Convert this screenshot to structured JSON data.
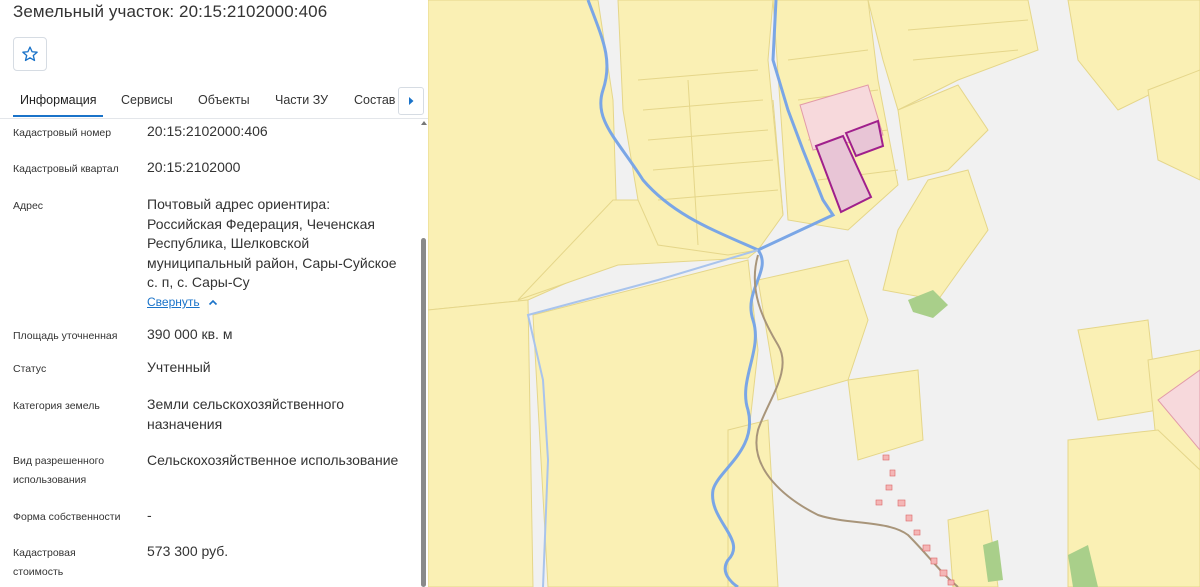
{
  "title": "Земельный участок: 20:15:2102000:406",
  "favorite_icon": "star-icon",
  "tabs": [
    {
      "label": "Информация",
      "active": true
    },
    {
      "label": "Сервисы"
    },
    {
      "label": "Объекты"
    },
    {
      "label": "Части ЗУ"
    },
    {
      "label": "Состав"
    }
  ],
  "tabs_next_icon": "chevron-right-icon",
  "info": {
    "cadastral_number_label": "Кадастровый номер",
    "cadastral_number": "20:15:2102000:406",
    "cadastral_quarter_label": "Кадастровый квартал",
    "cadastral_quarter": "20:15:2102000",
    "address_label": "Адрес",
    "address": "Почтовый адрес ориентира: Российская Федерация, Чеченская Республика, Шелковской муниципальный район, Сары-Суйское с. п, с. Сары-Су",
    "collapse_link": "Свернуть",
    "area_label": "Площадь уточненная",
    "area": "390 000 кв. м",
    "status_label": "Статус",
    "status": "Учтенный",
    "land_category_label": "Категория земель",
    "land_category": "Земли сельскохозяйственного назначения",
    "permitted_use_label": "Вид разрешенного использования",
    "permitted_use": "Сельскохозяйственное использование",
    "ownership_label": "Форма собственности",
    "ownership": "-",
    "cadastral_value_label": "Кадастровая стоимость",
    "cadastral_value": "573 300 руб."
  },
  "colors": {
    "accent": "#1a73c9",
    "parcel_fill": "#faf0b4",
    "parcel_stroke": "#e8d98a",
    "selected_parcel": "#a0208c",
    "river": "#7aa6e6",
    "road": "#a8957a"
  }
}
